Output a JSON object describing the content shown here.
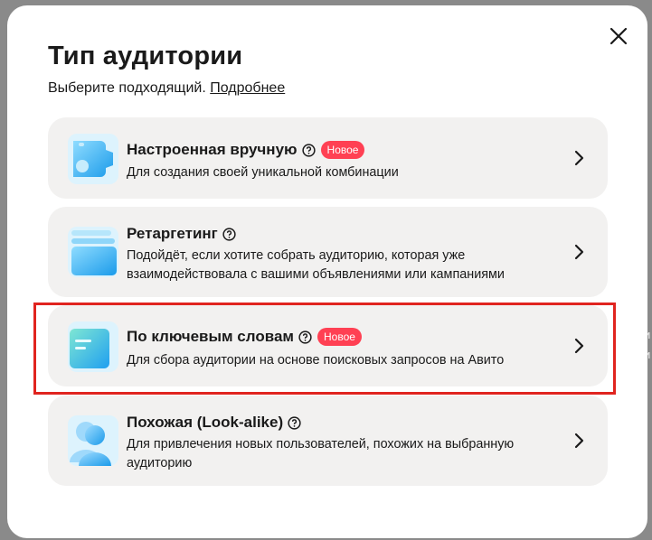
{
  "modal": {
    "title": "Тип аудитории",
    "subtitle_text": "Выберите подходящий.",
    "subtitle_link": "Подробнее"
  },
  "options": [
    {
      "title": "Настроенная вручную",
      "badge": "Новое",
      "description": "Для создания своей уникальной комбинации",
      "icon": "gear-icon"
    },
    {
      "title": "Ретаргетинг",
      "badge": "",
      "description": "Подойдёт, если хотите собрать аудиторию, которая уже взаимодействовала с вашими объявлениями или кампаниями",
      "icon": "stacked-cards-icon"
    },
    {
      "title": "По ключевым словам",
      "badge": "Новое",
      "description": "Для сбора аудитории на основе поисковых запросов на Авито",
      "icon": "search-bar-icon"
    },
    {
      "title": "Похожая (Look-alike)",
      "badge": "",
      "description": "Для привлечения новых пользователей, похожих на выбранную аудиторию",
      "icon": "people-icon"
    }
  ],
  "colors": {
    "badge": "#ff4053",
    "card_bg": "#f2f1f0",
    "highlight": "#e0241f",
    "icon_blue": "#1fa9f0"
  }
}
